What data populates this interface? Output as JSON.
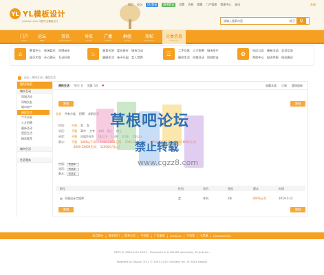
{
  "header": {
    "logo_badge": "YL",
    "logo_text": "YL模板设计",
    "logo_sub": "yldesign.com 中国专业模板设计",
    "links": [
      "首页",
      "论坛",
      "QQ登录",
      "微博登录",
      "设置",
      "消息",
      "提醒"
    ],
    "user_links": [
      "门户管理",
      "管理中心",
      "退出"
    ],
    "close_label": "关闭",
    "search_placeholder": "请输入搜索内容",
    "search_scope": "帖子",
    "search_button": "Q"
  },
  "nav": {
    "items": [
      {
        "cn": "门户",
        "en": "Portal"
      },
      {
        "cn": "论坛",
        "en": "BBS"
      },
      {
        "cn": "资讯",
        "en": "Information"
      },
      {
        "cn": "导航",
        "en": "Guide"
      },
      {
        "cn": "广播",
        "en": "Follow"
      },
      {
        "cn": "群组",
        "en": "Group"
      },
      {
        "cn": "淘帖",
        "en": "Collection"
      },
      {
        "cn": "分类信息",
        "en": "Category"
      }
    ]
  },
  "subnav": {
    "groups": [
      {
        "icon": "⌂",
        "links": [
          "教育中心",
          "休闲娱乐",
          "吃喝玩乐",
          "娱乐大观",
          "开心聊天",
          "互动问答"
        ]
      },
      {
        "icon": "♨",
        "links": [
          "美食天地",
          "爱在旅行",
          "城市互动",
          "健康生活",
          "亲子乐园",
          "女人世界"
        ]
      },
      {
        "icon": "☰",
        "links": [
          "二手交易",
          "人才招聘",
          "城市房产",
          "便民生活",
          "同城活动",
          "同城交友"
        ]
      },
      {
        "icon": "✿",
        "links": [
          "社区公告",
          "最新活动",
          "会员交流",
          "帮助中心",
          "投诉举报",
          "网站建议"
        ]
      }
    ]
  },
  "breadcrumb": {
    "items": [
      "论坛",
      "城市互动",
      "便民生活"
    ]
  },
  "sidebar": {
    "title": "版块导航",
    "section1": "城市互动",
    "items": [
      "同城活动",
      "同城交友",
      "城市房产",
      "便民生活",
      "二手交易",
      "人才招聘",
      "最新活动",
      "便民生活",
      "精彩推荐"
    ],
    "active_index": 3,
    "section2": "城市生活",
    "section3": "社区服务"
  },
  "content": {
    "title": "便民生活",
    "today_label": "今日: 0",
    "topics_label": "主题: 14",
    "fav_label": "收藏本版",
    "rss_label": "订阅",
    "manage_label": "管理面板",
    "post_button": "发帖",
    "filter_tabs": [
      "全部",
      "所有分类",
      "招聘",
      "求职信息"
    ],
    "rows": [
      {
        "label": "性别:",
        "options": [
          "不限",
          "男",
          "女"
        ]
      },
      {
        "label": "学历:",
        "options": [
          "不限",
          "高中",
          "大专",
          "本科",
          "硕士",
          "博士"
        ]
      },
      {
        "label": "经验:",
        "options": [
          "不限",
          "应届毕业生",
          "1年以下",
          "1-3年",
          "3-5年",
          "5年以上"
        ]
      },
      {
        "label": "薪水:",
        "options": [
          "不限",
          "1000以下/月",
          "1000-2000元/月",
          "2000-3000元/月",
          "3000-5000元/月",
          "5000-8000元/月",
          "8000-12000元/月",
          "12000元/月以上"
        ]
      }
    ],
    "selects": [
      {
        "label": "性别:",
        "value": "请选择"
      },
      {
        "label": "学历:",
        "value": "请选择"
      },
      {
        "label": "薪水:",
        "value": "请选择"
      }
    ],
    "table_headers": [
      "职位",
      "性别",
      "学历",
      "经验",
      "薪水",
      "时间"
    ],
    "table_row": {
      "title": "平面设计工程师",
      "gender": "女",
      "education": "本科",
      "experience": "2年",
      "salary": "8000元/月",
      "time": "2014-1-12"
    }
  },
  "footer": {
    "links": [
      "站点统计",
      "联系我们",
      "联系方式",
      "手机版",
      "广告服务",
      "Archiver",
      "手机版",
      "小黑屋",
      "Comsenz Inc."
    ],
    "gmt": "GMT+8, 2015-5-23 16:07 , Processed in 0.131487 second(s), 20 queries .",
    "powered": "Powered by Discuz! X3.2 © 2001-2013 Comsenz Inc.  YL Style Design"
  },
  "watermark": {
    "title": "草根吧论坛",
    "sub": "禁止转载",
    "url": "www.cgzz8.com"
  },
  "colors": {
    "accent": "#f5a020",
    "link": "#e66a1a",
    "watermark": "#2f6fb3"
  }
}
